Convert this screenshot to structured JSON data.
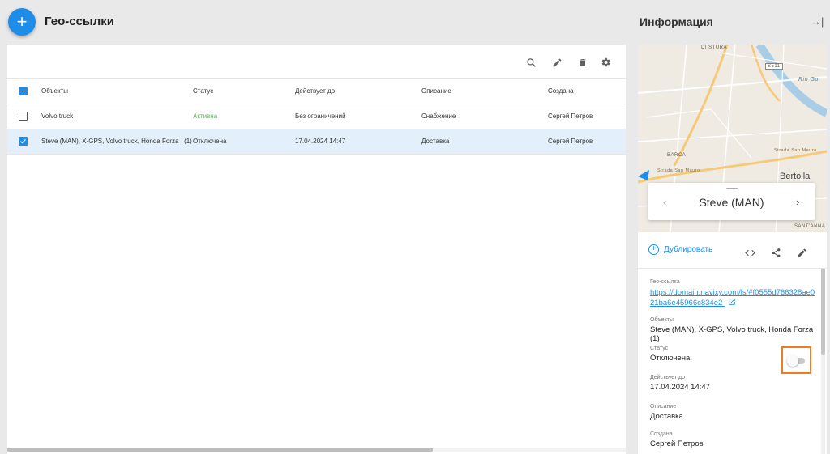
{
  "header": {
    "add_label": "+",
    "title": "Гео-ссылки"
  },
  "toolbar": {
    "icons": [
      "search-icon",
      "edit-icon",
      "delete-icon",
      "settings-icon"
    ]
  },
  "table": {
    "columns": [
      "Объекты",
      "Статус",
      "Действует до",
      "Описание",
      "Создана"
    ],
    "rows": [
      {
        "objects": "Volvo truck",
        "count": "",
        "status": "Активна",
        "valid_until": "Без ограничений",
        "description": "Снабжение",
        "created_by": "Сергей Петров",
        "checked": false,
        "status_color": "#5cb25c"
      },
      {
        "objects": "Steve (MAN), X-GPS, Volvo truck, Honda Forza",
        "count": "(1)",
        "status": "Отключена",
        "valid_until": "17.04.2024 14:47",
        "description": "Доставка",
        "created_by": "Сергей Петров",
        "checked": true,
        "status_color": "#333333"
      }
    ]
  },
  "info": {
    "title": "Информация",
    "collapse_label": "→|",
    "map_labels": [
      "DI STURA",
      "S511",
      "Rio Gu",
      "BARCA",
      "Strada San Mauro",
      "Strada San Mauro",
      "Bertolla",
      "SANT'ANNA"
    ],
    "object_name": "Steve (MAN)",
    "prev_label": "‹",
    "next_label": "›",
    "duplicate_label": "Дублировать",
    "fields": {
      "link_label": "Гео-ссылка",
      "link_value": "https://domain.navixy.com/ls/#f0555d766328ae021ba6e45966c834e2",
      "objects_label": "Объекты",
      "objects_value": "Steve (MAN), X-GPS, Volvo truck, Honda Forza (1)",
      "status_label": "Статус",
      "status_value": "Отключена",
      "valid_label": "Действует до",
      "valid_value": "17.04.2024 14:47",
      "description_label": "Описание",
      "description_value": "Доставка",
      "created_label": "Создана",
      "created_value": "Сергей Петров"
    },
    "status_toggle_on": false
  },
  "colors": {
    "accent": "#1e8de8",
    "active_status": "#5cb25c",
    "highlight": "#ef7b22",
    "selected_row": "#e3f0fb"
  }
}
